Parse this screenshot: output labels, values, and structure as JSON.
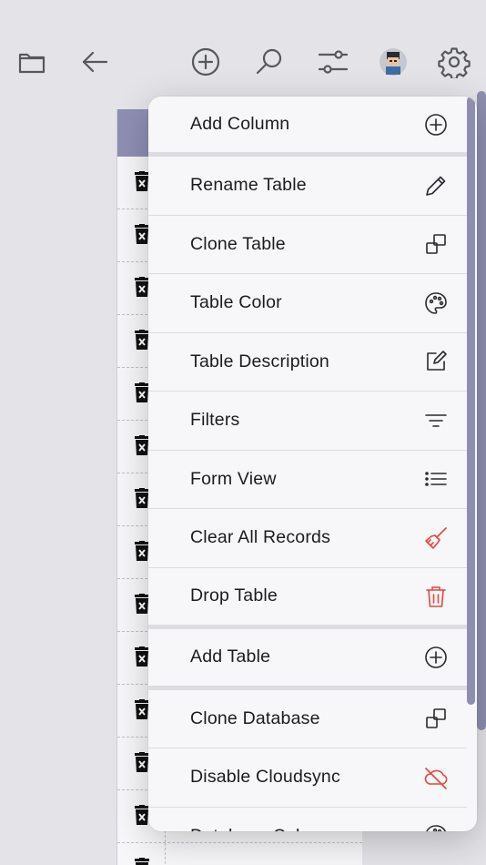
{
  "toolbar": {
    "icons": [
      "folder-icon",
      "back-arrow-icon",
      "add-circle-icon",
      "search-icon",
      "sliders-icon",
      "avatar",
      "settings-gear-icon"
    ]
  },
  "table": {
    "row_icon": "trash-delete-icon",
    "row_count": 14
  },
  "menu": {
    "items": [
      {
        "label": "Add Column",
        "icon": "plus-circle-icon",
        "danger": false
      },
      {
        "label": "Rename Table",
        "icon": "pencil-icon",
        "danger": false
      },
      {
        "label": "Clone Table",
        "icon": "clone-icon",
        "danger": false
      },
      {
        "label": "Table Color",
        "icon": "palette-icon",
        "danger": false
      },
      {
        "label": "Table Description",
        "icon": "edit-note-icon",
        "danger": false
      },
      {
        "label": "Filters",
        "icon": "filter-icon",
        "danger": false
      },
      {
        "label": "Form View",
        "icon": "list-icon",
        "danger": false
      },
      {
        "label": "Clear All Records",
        "icon": "broom-icon",
        "danger": true
      },
      {
        "label": "Drop Table",
        "icon": "trash-icon",
        "danger": true
      },
      {
        "label": "Add Table",
        "icon": "plus-circle-icon",
        "danger": false
      },
      {
        "label": "Clone Database",
        "icon": "clone-icon",
        "danger": false
      },
      {
        "label": "Disable Cloudsync",
        "icon": "cloud-off-icon",
        "danger": true
      },
      {
        "label": "Database Color",
        "icon": "palette-icon",
        "danger": false
      }
    ]
  },
  "colors": {
    "accent": "#8e8fb4",
    "danger": "#e8453c",
    "background": "#e4e4e8",
    "menu_bg": "#f7f7f9"
  }
}
